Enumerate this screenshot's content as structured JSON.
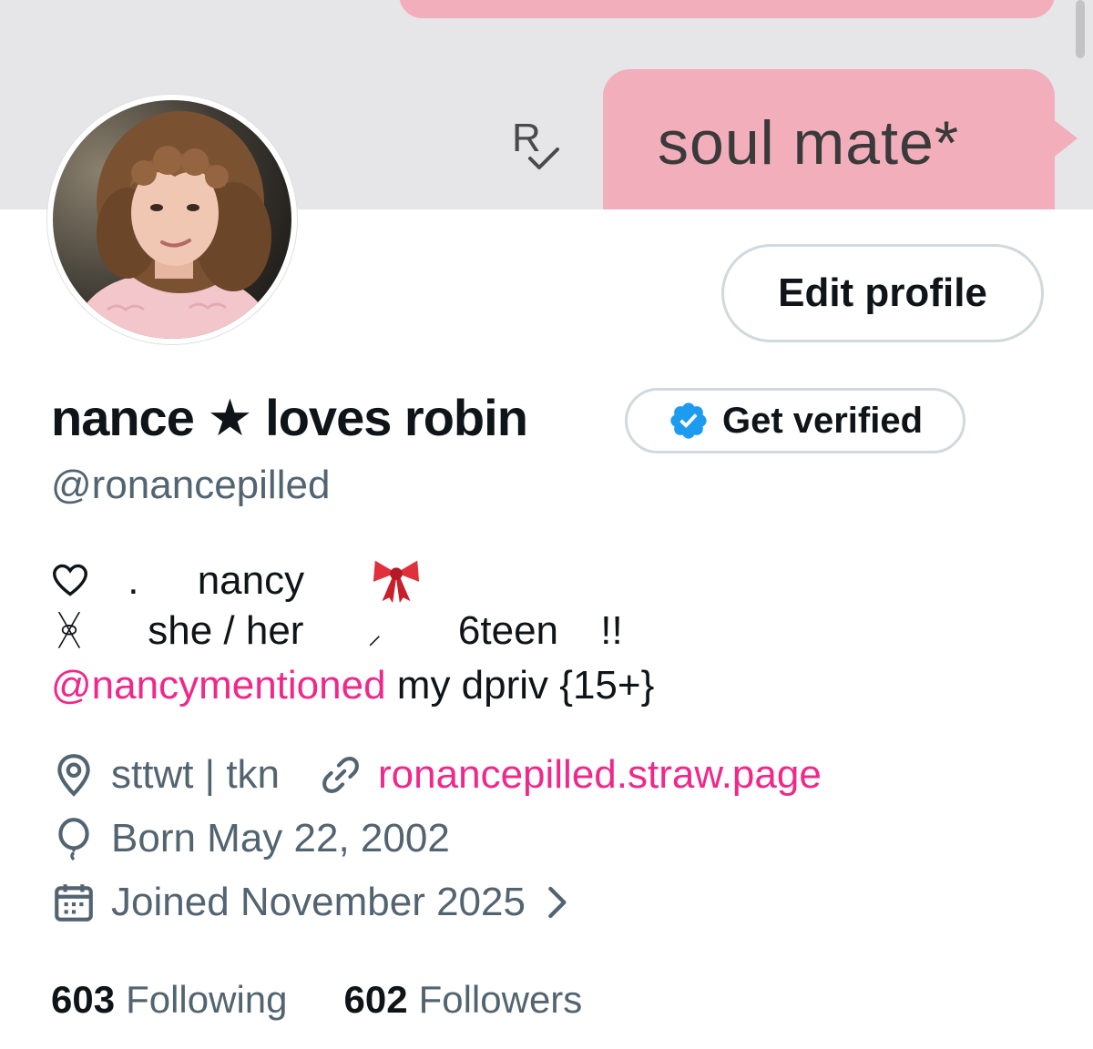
{
  "banner": {
    "message_text": "soul mate*",
    "read_receipt": "R"
  },
  "actions": {
    "edit_profile_label": "Edit profile",
    "get_verified_label": "Get verified"
  },
  "profile": {
    "display_name": "nance ★ loves robin",
    "handle": "@ronancepilled"
  },
  "bio": {
    "line1_dot": ".",
    "line1_name": "nancy",
    "line2_glyph": "ᚸ",
    "line2_pronouns": "she / her",
    "line2_separator": "⸝",
    "line2_age": "6teen",
    "line2_exclaim": "!!",
    "line3_mention": "@nancymentioned",
    "line3_text": " my dpriv {15+}"
  },
  "meta": {
    "location": "sttwt | tkn",
    "website": "ronancepilled.straw.page",
    "birthday": "Born May 22, 2002",
    "joined": "Joined November 2025"
  },
  "stats": {
    "following_count": "603",
    "following_label": "Following",
    "followers_count": "602",
    "followers_label": "Followers"
  },
  "colors": {
    "banner_bg": "#e6e5e8",
    "bubble": "#f2aebb",
    "accent_link": "#f0288a",
    "verified_blue": "#1d9bf0",
    "secondary_text": "#536471"
  },
  "icons": {
    "bio_heart": "heart-outline-icon",
    "bio_bow": "ribbon-bow-icon",
    "location": "location-pin-icon",
    "website": "link-icon",
    "birthday": "balloon-icon",
    "joined": "calendar-icon",
    "joined_more": "chevron-right-icon",
    "verified": "verified-badge-icon"
  }
}
